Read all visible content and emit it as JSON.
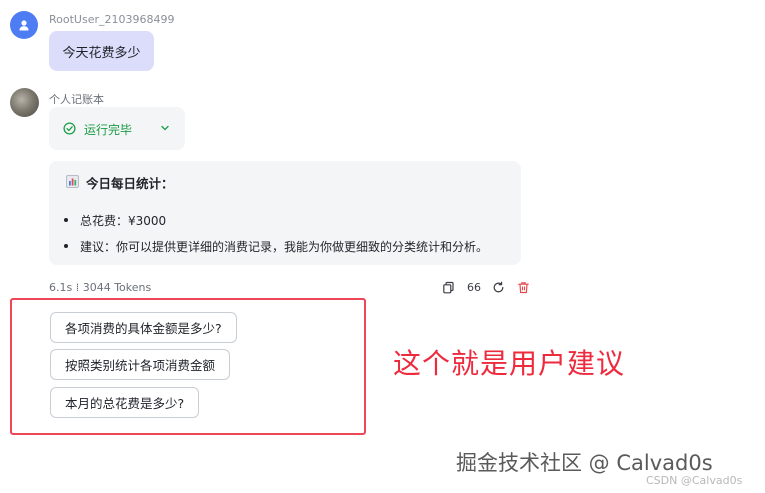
{
  "user": {
    "name": "RootUser_2103968499",
    "message": "今天花费多少"
  },
  "bot": {
    "name": "个人记账本",
    "run_status": "运行完毕",
    "stats_title": "今日每日统计：",
    "stats_lines": [
      "总花费：¥3000",
      "建议：你可以提供更详细的消费记录，我能为你做更细致的分类统计和分析。"
    ],
    "meta": "6.1s ⁞ 3044 Tokens",
    "quote_label": "66"
  },
  "suggestions": [
    "各项消费的具体金额是多少?",
    "按照类别统计各项消费金额",
    "本月的总花费是多少?"
  ],
  "annotation": "这个就是用户建议",
  "watermark": {
    "main": "掘金技术社区 @ Calvad0s",
    "sub": "CSDN @Calvad0s"
  },
  "colors": {
    "user_bubble": "#dcdcfb",
    "success": "#1a9c46",
    "annotation_red": "#ee2a3d",
    "delete_red": "#e5484d"
  },
  "icons": {
    "user_avatar": "person-icon",
    "run_status": "check-circle-icon",
    "expand": "chevron-down-icon",
    "stats": "bar-chart-emoji-icon",
    "copy": "copy-icon",
    "regenerate": "refresh-icon",
    "delete": "trash-icon"
  }
}
